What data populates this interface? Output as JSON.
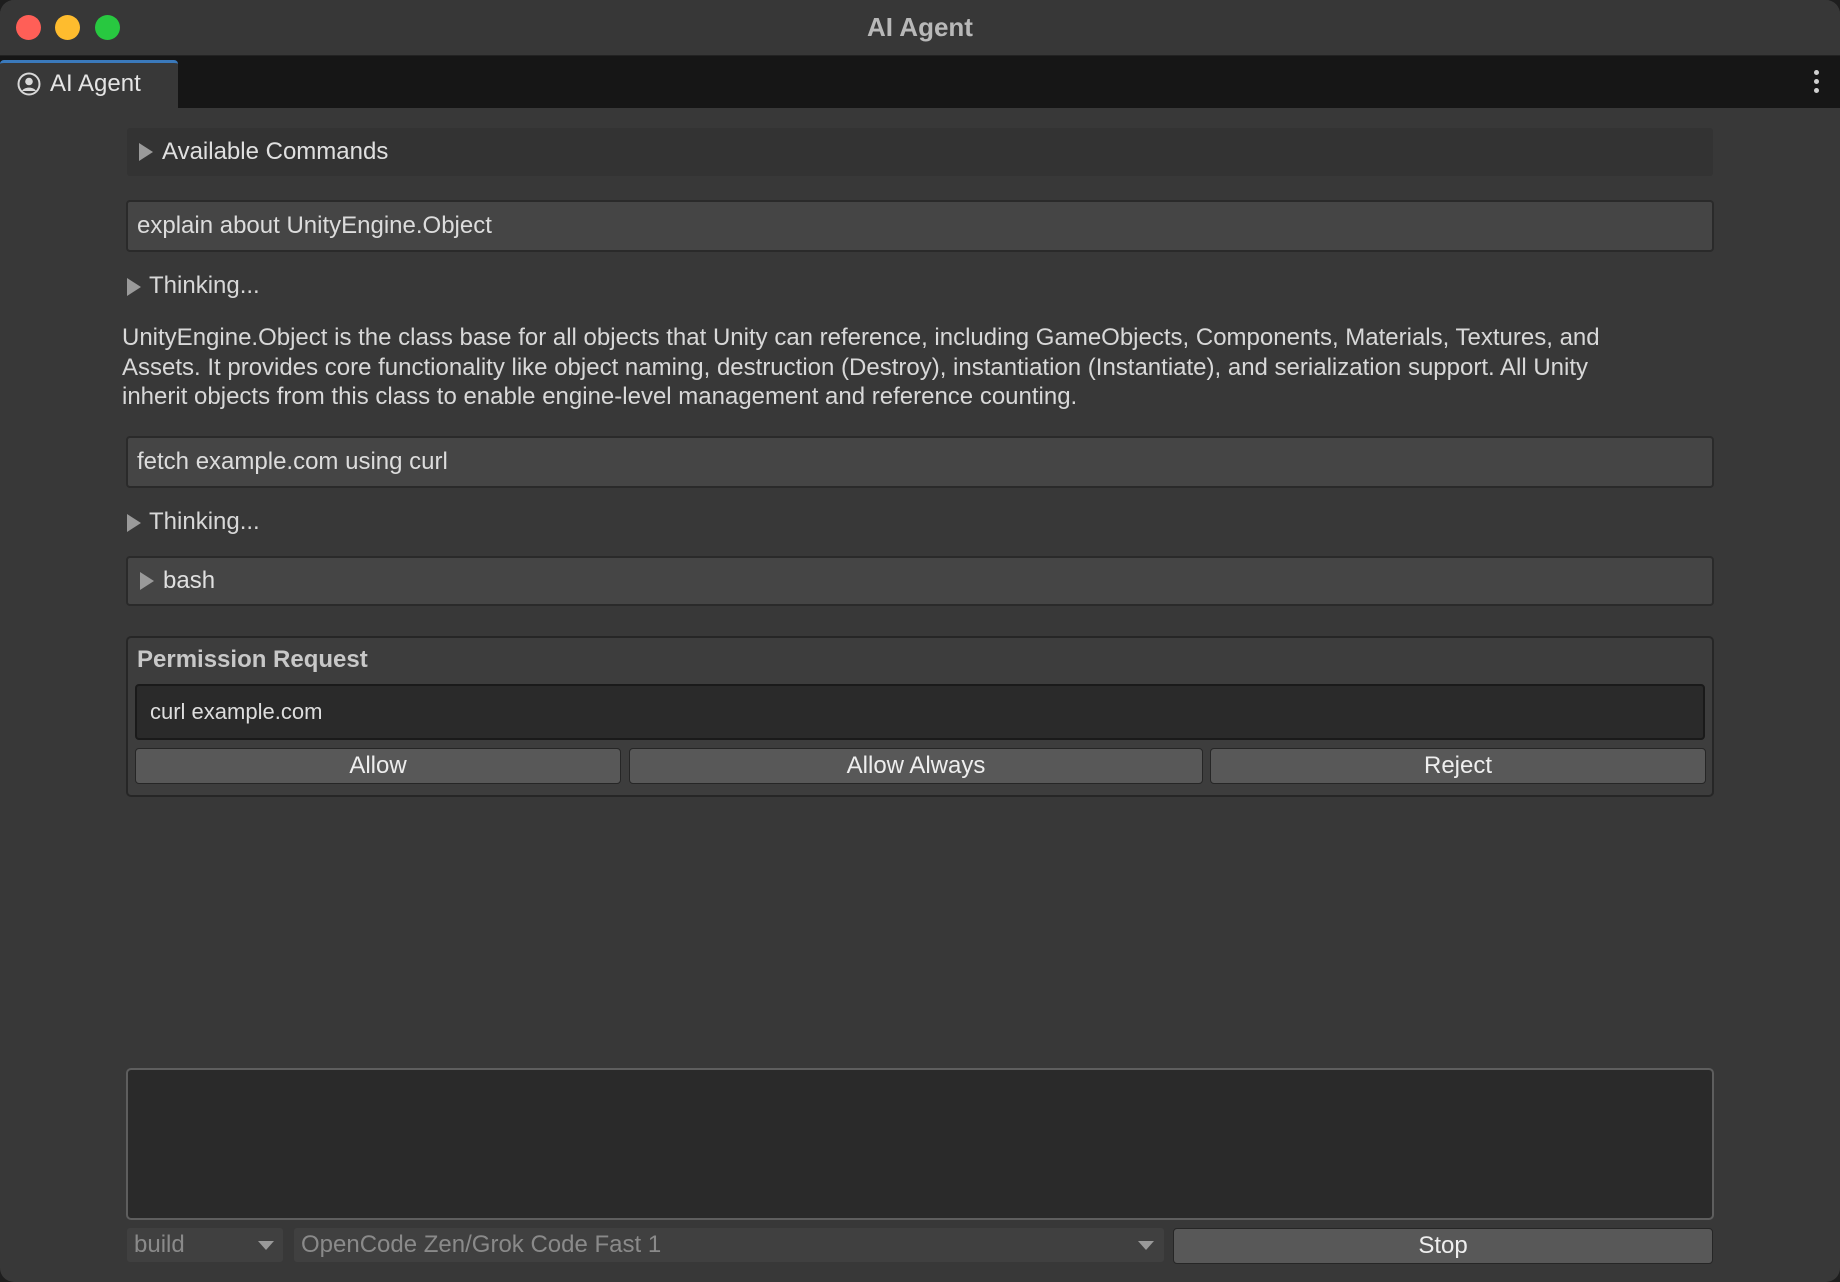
{
  "window": {
    "title": "AI Agent",
    "colors": {
      "close": "#ff5f57",
      "minimize": "#febc2e",
      "maximize": "#28c840",
      "tab_accent": "#3a79bb"
    }
  },
  "tab": {
    "label": "AI Agent",
    "icon": "user-circle-icon"
  },
  "commands_foldout": {
    "label": "Available Commands",
    "expanded": false
  },
  "conversation": {
    "message_1": "explain about UnityEngine.Object",
    "thinking_1": "Thinking...",
    "response_1_lines": [
      "UnityEngine.Object is the class base for all objects that Unity can reference, including GameObjects, Components, Materials, Textures, and",
      "Assets. It provides core functionality like object naming, destruction (Destroy), instantiation (Instantiate), and serialization support. All Unity",
      "inherit objects from this class to enable engine-level management and reference counting."
    ],
    "message_2": "fetch example.com using curl",
    "thinking_2": "Thinking...",
    "tool_call": "bash"
  },
  "permission": {
    "title": "Permission Request",
    "command": "curl example.com",
    "allow_label": "Allow",
    "allow_always_label": "Allow Always",
    "reject_label": "Reject"
  },
  "input": {
    "value": ""
  },
  "footer": {
    "mode": "build",
    "model": "OpenCode Zen/Grok Code Fast 1",
    "stop_label": "Stop"
  }
}
